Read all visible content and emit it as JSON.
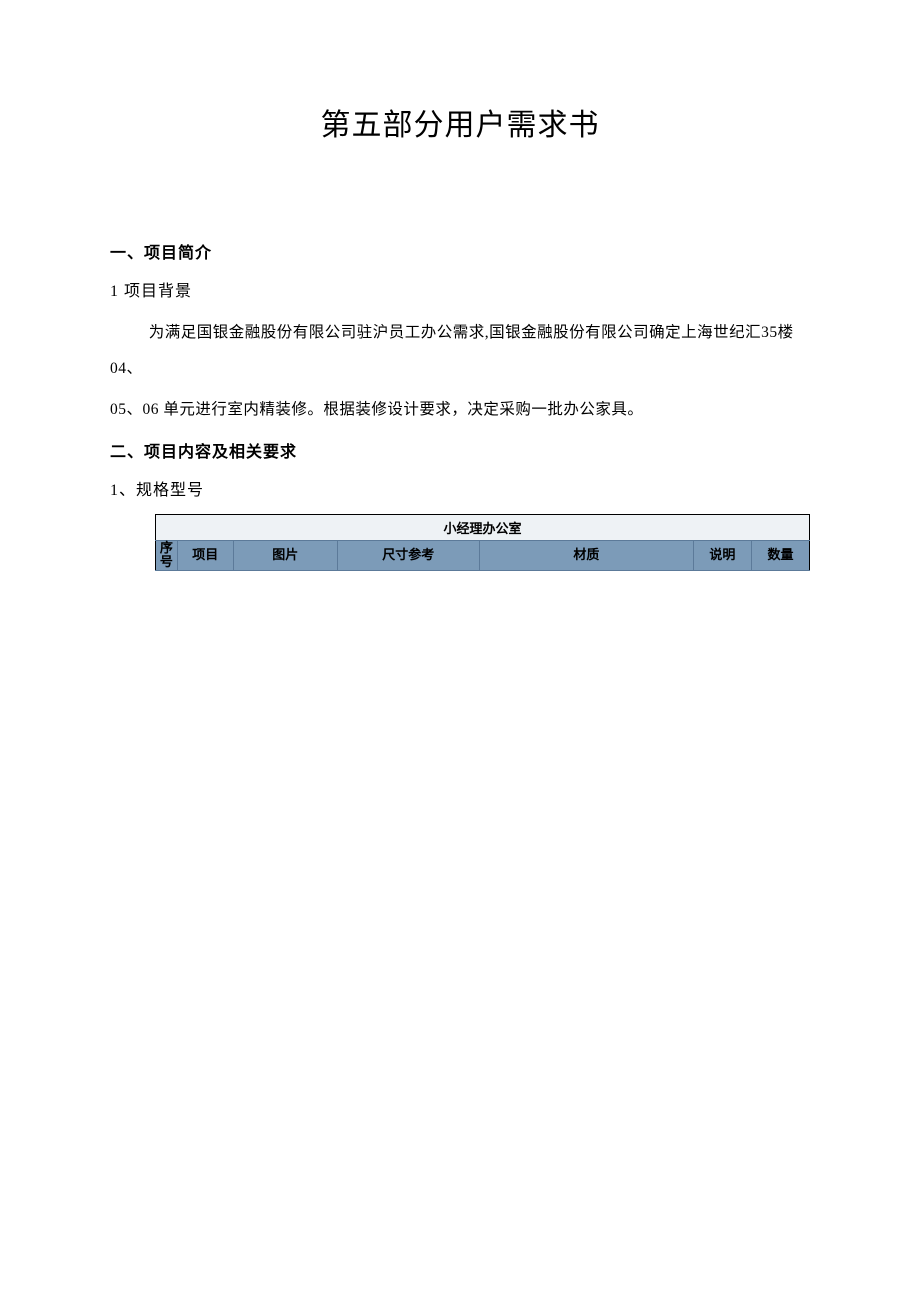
{
  "title": "第五部分用户需求书",
  "section1": {
    "heading": "一、项目简介",
    "sub": "1 项目背景",
    "para_line1": "为满足国银金融股份有限公司驻沪员工办公需求,国银金融股份有限公司确定上海世纪汇35楼04、",
    "para_line2": "05、06 单元进行室内精装修。根据装修设计要求，决定采购一批办公家具。"
  },
  "section2": {
    "heading": "二、项目内容及相关要求",
    "sub": "1、规格型号"
  },
  "table": {
    "title": "小经理办公室",
    "columns": {
      "seq": "序号",
      "item": "项目",
      "pic": "图片",
      "size": "尺寸参考",
      "material": "材质",
      "desc": "说明",
      "qty": "数量"
    }
  }
}
